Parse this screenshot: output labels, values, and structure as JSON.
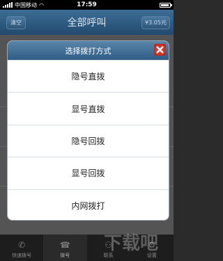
{
  "status_bar": {
    "carrier": "中国移动",
    "time": "17:59"
  },
  "navbar": {
    "left_button": "清空",
    "title": "全部呼叫",
    "right_button": "¥3.05元"
  },
  "dialog": {
    "title": "选择拨打方式",
    "options": [
      {
        "label": "隐号直拨"
      },
      {
        "label": "显号直拨"
      },
      {
        "label": "隐号回拨"
      },
      {
        "label": "显号回拨"
      },
      {
        "label": "内网拨打"
      }
    ]
  },
  "tabbar": {
    "items": [
      {
        "label": "快速拨号",
        "icon": "phone-icon"
      },
      {
        "label": "拨号",
        "icon": "dialpad-icon"
      },
      {
        "label": "联系",
        "icon": "contacts-icon"
      },
      {
        "label": "设置",
        "icon": "settings-icon"
      }
    ]
  },
  "watermark": {
    "text": "下载吧"
  },
  "colors": {
    "navbar_top": "#3c6e96",
    "navbar_bottom": "#234a6e",
    "dialog_header": "#2f5c85",
    "close_button": "#d52a1e"
  }
}
